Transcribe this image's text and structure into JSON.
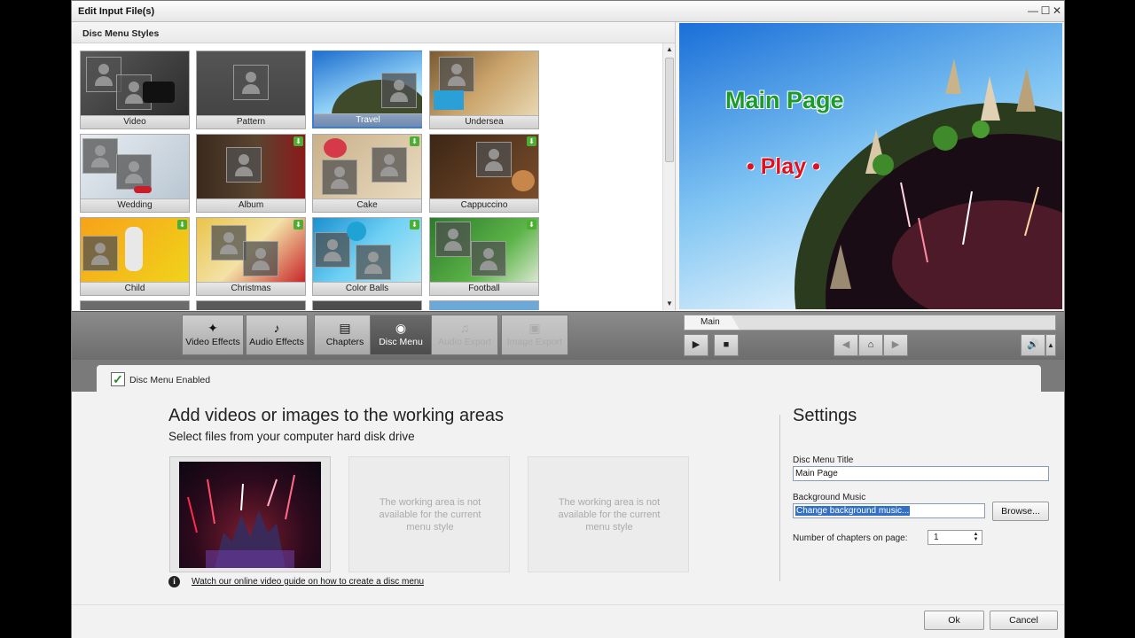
{
  "window": {
    "title": "Edit Input File(s)",
    "minimize": "—",
    "maximize": "☐",
    "close": "✕"
  },
  "styles": {
    "header": "Disc Menu Styles",
    "items": [
      {
        "label": "Video",
        "download": false
      },
      {
        "label": "Pattern",
        "download": false
      },
      {
        "label": "Travel",
        "download": false,
        "selected": true
      },
      {
        "label": "Undersea",
        "download": false
      },
      {
        "label": "Wedding",
        "download": false
      },
      {
        "label": "Album",
        "download": true
      },
      {
        "label": "Cake",
        "download": true
      },
      {
        "label": "Cappuccino",
        "download": true
      },
      {
        "label": "Child",
        "download": true
      },
      {
        "label": "Christmas",
        "download": true
      },
      {
        "label": "Color Balls",
        "download": true
      },
      {
        "label": "Football",
        "download": true
      }
    ]
  },
  "preview": {
    "title": "Main Page",
    "play": "• Play •"
  },
  "toolbar": {
    "video_effects": "Video Effects",
    "audio_effects": "Audio Effects",
    "chapters": "Chapters",
    "disc_menu": "Disc Menu",
    "audio_export": "Audio Export",
    "image_export": "Image Export"
  },
  "player": {
    "tab": "Main",
    "play": "▶",
    "stop": "■",
    "prev": "◀",
    "home": "⌂",
    "next": "▶",
    "volume": "🔊",
    "volume_arrow": "▲"
  },
  "disc_menu": {
    "enabled_label": "Disc Menu Enabled",
    "heading": "Add videos or images to the working areas",
    "subheading": "Select files from your computer hard disk drive",
    "unavailable_msg": "The working area is not available for the current menu style",
    "guide_link": "Watch our online video guide on how to create a disc menu"
  },
  "settings": {
    "heading": "Settings",
    "title_label": "Disc Menu Title",
    "title_value": "Main Page",
    "music_label": "Background Music",
    "music_value": "Change background music...",
    "browse": "Browse...",
    "chapters_label": "Number of chapters on page:",
    "chapters_value": "1"
  },
  "footer": {
    "ok": "Ok",
    "cancel": "Cancel"
  },
  "colors": {
    "accent": "#3a7fd5",
    "preview_title": "#1a9b2a",
    "preview_play": "#e01020",
    "selection": "#3270c4"
  }
}
